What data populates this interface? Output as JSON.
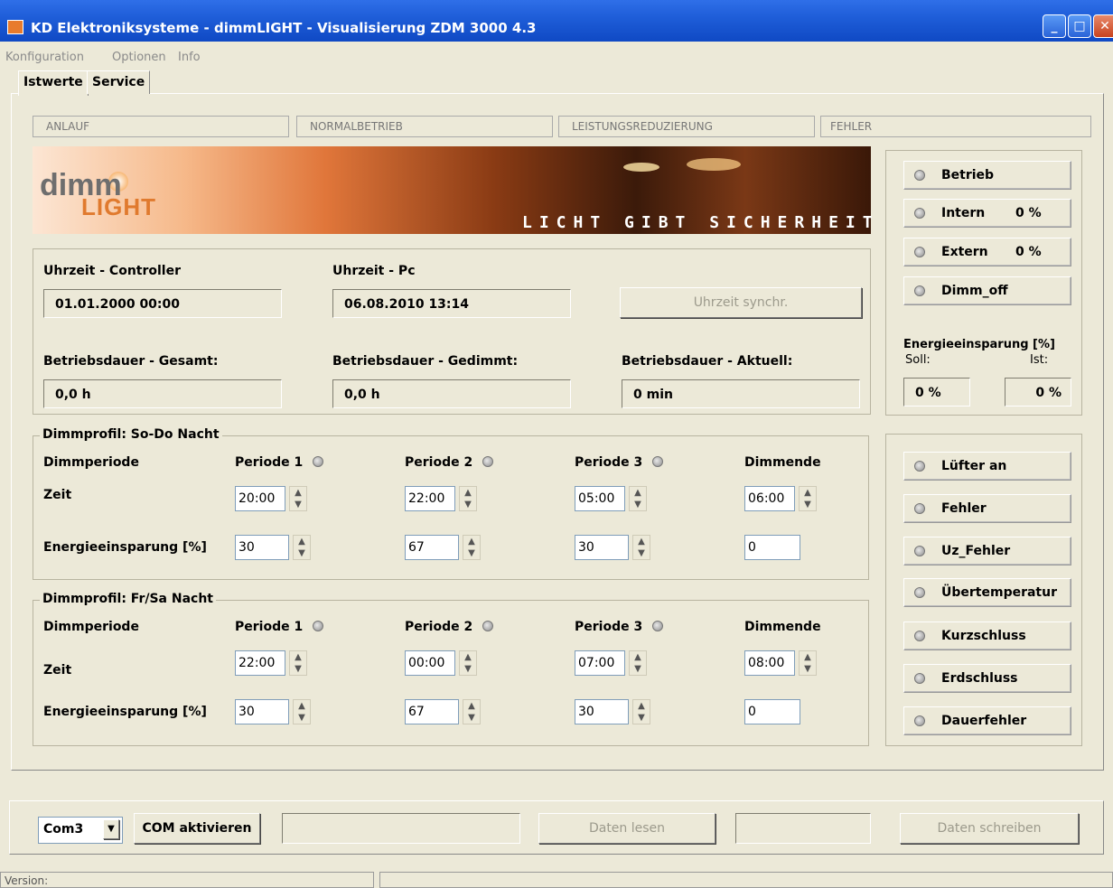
{
  "window": {
    "title": "KD Elektroniksysteme - dimmLIGHT - Visualisierung ZDM 3000 4.3",
    "minimize": "_",
    "maximize": "□",
    "close": "✕"
  },
  "menu": [
    "Konfiguration",
    "Optionen",
    "Info"
  ],
  "tabs": [
    "Istwerte",
    "Service"
  ],
  "status_segments": [
    "ANLAUF",
    "NORMALBETRIEB",
    "LEISTUNGSREDUZIERUNG",
    "FEHLER"
  ],
  "banner": {
    "logo_dimm": "dimm",
    "logo_light": "LIGHT",
    "slogan": "LICHT GIBT SICHERHEIT"
  },
  "clock": {
    "controller_label": "Uhrzeit - Controller",
    "controller_value": "01.01.2000   00:00",
    "pc_label": "Uhrzeit - Pc",
    "pc_value": "06.08.2010   13:14",
    "sync_button": "Uhrzeit synchr."
  },
  "runtime": {
    "total_label": "Betriebsdauer - Gesamt:",
    "total_value": "0,0 h",
    "dimmed_label": "Betriebsdauer - Gedimmt:",
    "dimmed_value": "0,0 h",
    "current_label": "Betriebsdauer - Aktuell:",
    "current_value": "0 min"
  },
  "profile1": {
    "title": "Dimmprofil: So-Do Nacht",
    "period_label": "Dimmperiode",
    "time_label": "Zeit",
    "saving_label": "Energieeinsparung [%]",
    "p1": "Periode 1",
    "p2": "Periode 2",
    "p3": "Periode 3",
    "end": "Dimmende",
    "times": [
      "20:00",
      "22:00",
      "05:00",
      "06:00"
    ],
    "savings": [
      "30",
      "67",
      "30",
      "0"
    ]
  },
  "profile2": {
    "title": "Dimmprofil: Fr/Sa Nacht",
    "period_label": "Dimmperiode",
    "time_label": "Zeit",
    "saving_label": "Energieeinsparung [%]",
    "p1": "Periode 1",
    "p2": "Periode 2",
    "p3": "Periode 3",
    "end": "Dimmende",
    "times": [
      "22:00",
      "00:00",
      "07:00",
      "08:00"
    ],
    "savings": [
      "30",
      "67",
      "30",
      "0"
    ]
  },
  "right_panel": {
    "betrieb": "Betrieb",
    "intern": "Intern",
    "intern_val": "0 %",
    "extern": "Extern",
    "extern_val": "0 %",
    "dimm_off": "Dimm_off",
    "energy_title": "Energieeinsparung [%]",
    "soll": "Soll:",
    "ist": "Ist:",
    "soll_val": "0 %",
    "ist_val": "0 %"
  },
  "faults": [
    "Lüfter an",
    "Fehler",
    "Uz_Fehler",
    "Übertemperatur",
    "Kurzschluss",
    "Erdschluss",
    "Dauerfehler"
  ],
  "bottom": {
    "port": "Com3",
    "activate": "COM aktivieren",
    "read": "Daten lesen",
    "write": "Daten schreiben"
  },
  "statusbar": {
    "version": "Version:"
  }
}
